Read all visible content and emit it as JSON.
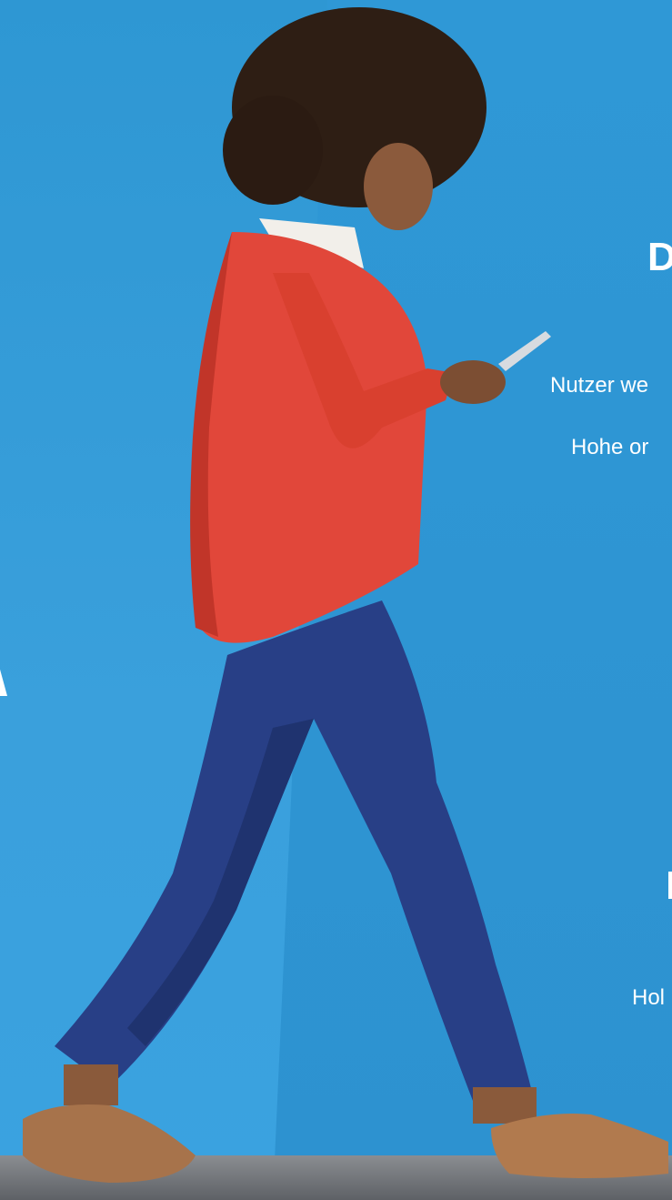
{
  "headline": "D",
  "body_lines": [
    "Nutzer we",
    "Hohe or",
    "Hol"
  ],
  "colors": {
    "background": "#2f9ad6",
    "text": "#ffffff",
    "sweater": "#e1473a",
    "jeans": "#283f86"
  }
}
